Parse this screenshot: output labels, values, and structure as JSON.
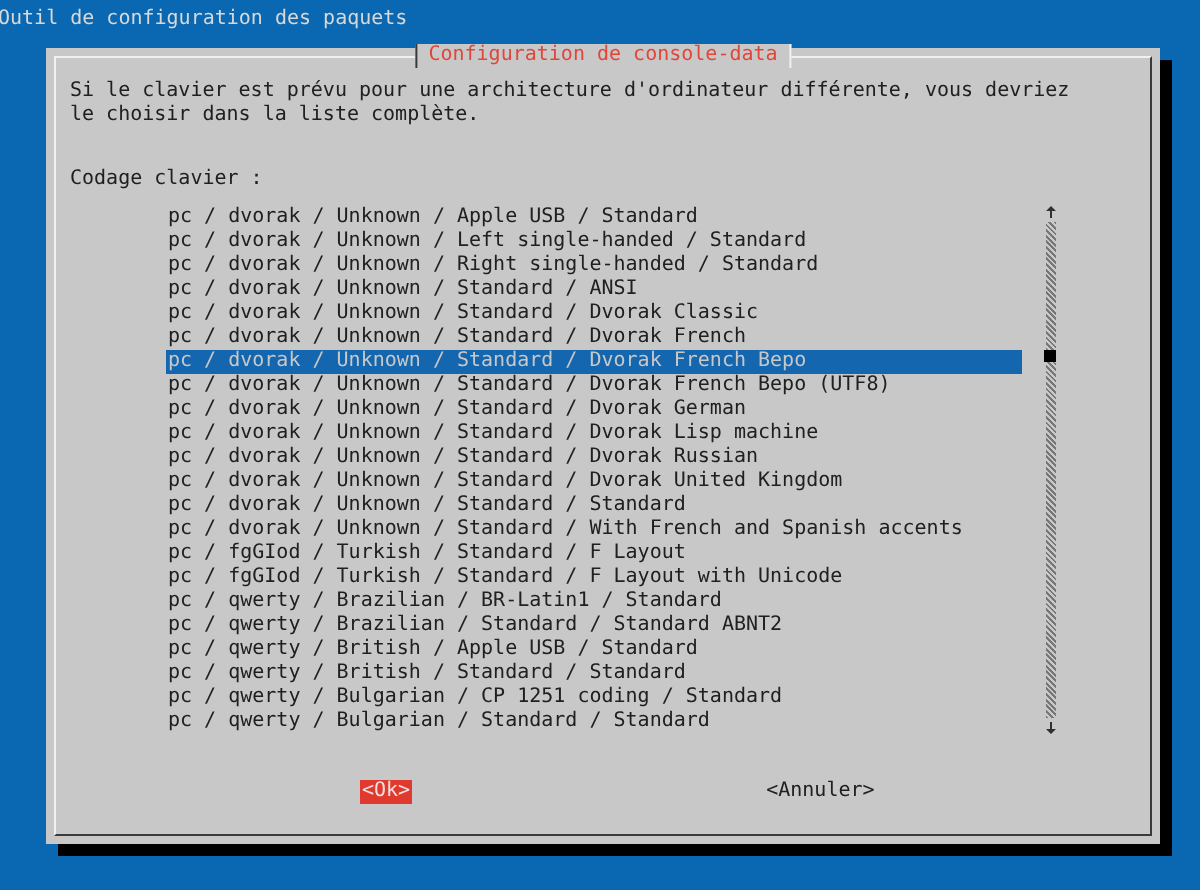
{
  "screen_title": "Outil de configuration des paquets",
  "dialog": {
    "title": "Configuration de console-data",
    "message": "Si le clavier est prévu pour une architecture d'ordinateur différente, vous devriez le choisir dans la liste complète.",
    "list_label": "Codage clavier :",
    "items": [
      {
        "label": "pc / dvorak / Unknown / Apple USB / Standard",
        "selected": false
      },
      {
        "label": "pc / dvorak / Unknown / Left single-handed / Standard",
        "selected": false
      },
      {
        "label": "pc / dvorak / Unknown / Right single-handed / Standard",
        "selected": false
      },
      {
        "label": "pc / dvorak / Unknown / Standard / ANSI",
        "selected": false
      },
      {
        "label": "pc / dvorak / Unknown / Standard / Dvorak Classic",
        "selected": false
      },
      {
        "label": "pc / dvorak / Unknown / Standard / Dvorak French",
        "selected": false
      },
      {
        "label": "pc / dvorak / Unknown / Standard / Dvorak French Bepo",
        "selected": true
      },
      {
        "label": "pc / dvorak / Unknown / Standard / Dvorak French Bepo (UTF8)",
        "selected": false
      },
      {
        "label": "pc / dvorak / Unknown / Standard / Dvorak German",
        "selected": false
      },
      {
        "label": "pc / dvorak / Unknown / Standard / Dvorak Lisp machine",
        "selected": false
      },
      {
        "label": "pc / dvorak / Unknown / Standard / Dvorak Russian",
        "selected": false
      },
      {
        "label": "pc / dvorak / Unknown / Standard / Dvorak United Kingdom",
        "selected": false
      },
      {
        "label": "pc / dvorak / Unknown / Standard / Standard",
        "selected": false
      },
      {
        "label": "pc / dvorak / Unknown / Standard / With French and Spanish accents",
        "selected": false
      },
      {
        "label": "pc / fgGIod / Turkish / Standard / F Layout",
        "selected": false
      },
      {
        "label": "pc / fgGIod / Turkish / Standard / F Layout with Unicode",
        "selected": false
      },
      {
        "label": "pc / qwerty / Brazilian / BR-Latin1 / Standard",
        "selected": false
      },
      {
        "label": "pc / qwerty / Brazilian / Standard / Standard ABNT2",
        "selected": false
      },
      {
        "label": "pc / qwerty / British / Apple USB / Standard",
        "selected": false
      },
      {
        "label": "pc / qwerty / British / Standard / Standard",
        "selected": false
      },
      {
        "label": "pc / qwerty / Bulgarian / CP 1251 coding / Standard",
        "selected": false
      },
      {
        "label": "pc / qwerty / Bulgarian / Standard / Standard",
        "selected": false
      }
    ],
    "buttons": [
      {
        "label": "<Ok>",
        "selected": true
      },
      {
        "label": "<Annuler>",
        "selected": false
      }
    ]
  }
}
